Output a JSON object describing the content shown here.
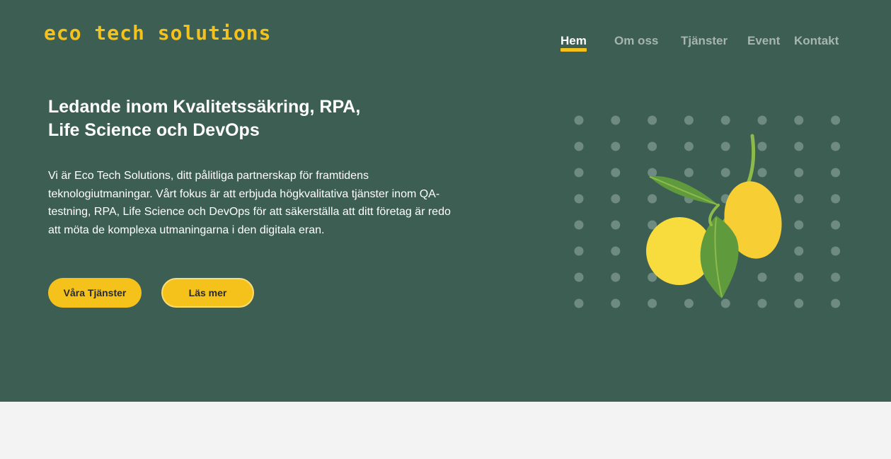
{
  "brand": {
    "logo_text": "eco tech solutions",
    "accent_color": "#f5c21b",
    "background_color": "#3c5e53"
  },
  "nav": {
    "items": [
      {
        "label": "Hem",
        "active": true
      },
      {
        "label": "Om oss",
        "active": false
      },
      {
        "label": "Tjänster",
        "active": false
      },
      {
        "label": "Event",
        "active": false
      },
      {
        "label": "Kontakt",
        "active": false
      }
    ]
  },
  "hero": {
    "headline_line1": "Ledande inom Kvalitetssäkring, RPA,",
    "headline_line2": "Life Science och DevOps",
    "intro": "Vi är Eco Tech Solutions, ditt pålitliga partnerskap för framtidens teknologiutmaningar. Vårt fokus är att erbjuda högkvalitativa tjänster inom QA-testning, RPA, Life Science och DevOps för att säkerställa att ditt företag är redo att möta de komplexa utmaningarna i den digitala eran.",
    "primary_button": "Våra Tjänster",
    "secondary_button": "Läs mer",
    "illustration": "lemon-branch-icon"
  }
}
